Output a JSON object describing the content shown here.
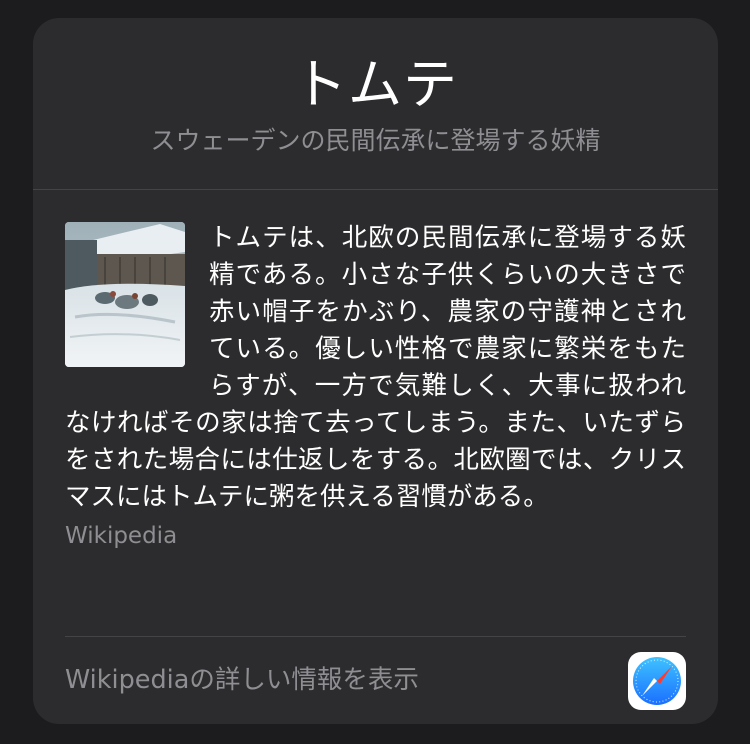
{
  "card": {
    "title": "トムテ",
    "subtitle": "スウェーデンの民間伝承に登場する妖精",
    "description": "トムテは、北欧の民間伝承に登場する妖精である。小さな子供くらいの大きさで赤い帽子をかぶり、農家の守護神とされている。優しい性格で農家に繁栄をもたらすが、一方で気難しく、大事に扱われなければその家は捨て去ってしまう。また、いたずらをされた場合には仕返しをする。北欧圏では、クリスマスにはトムテに粥を供える習慣がある。",
    "source": "Wikipedia",
    "more_link": "Wikipediaの詳しい情報を表示",
    "thumbnail_icon": "painting-thumbnail",
    "app_icon": "safari-compass-icon"
  },
  "colors": {
    "background": "#1c1c1e",
    "card": "#2c2c2e",
    "text": "#ffffff",
    "secondary_text": "#8e8e93",
    "safari_blue": "#1a8cff"
  }
}
